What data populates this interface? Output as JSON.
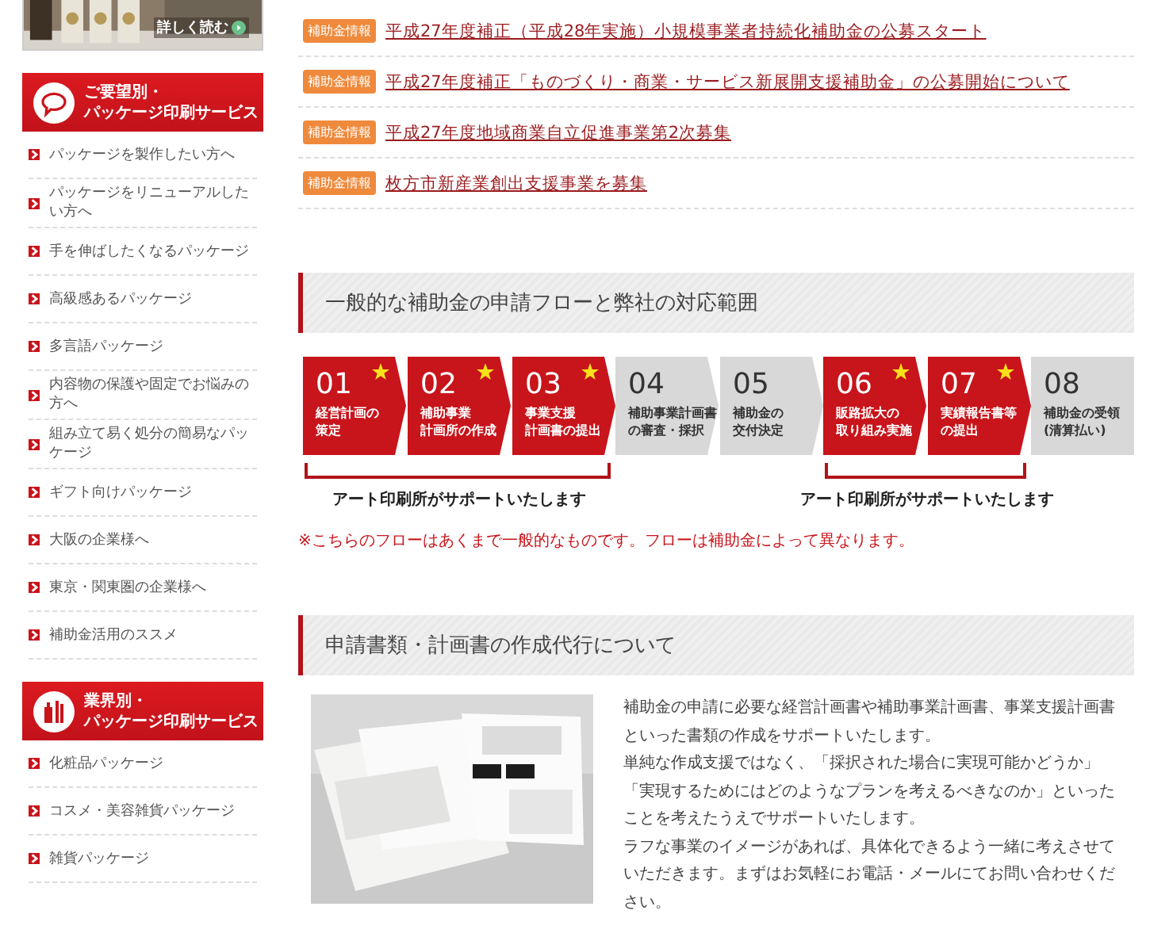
{
  "sidebar": {
    "banner": {
      "link": "詳しく読む"
    },
    "sections": [
      {
        "title": [
          "ご要望別・",
          "パッケージ印刷サービス"
        ],
        "items": [
          "パッケージを製作したい方へ",
          "パッケージをリニューアルしたい方へ",
          "手を伸ばしたくなるパッケージ",
          "高級感あるパッケージ",
          "多言語パッケージ",
          "内容物の保護や固定でお悩みの方へ",
          "組み立て易く処分の簡易なパッケージ",
          "ギフト向けパッケージ",
          "大阪の企業様へ",
          "東京・関東圏の企業様へ",
          "補助金活用のススメ"
        ]
      },
      {
        "title": [
          "業界別・",
          "パッケージ印刷サービス"
        ],
        "items": [
          "化粧品パッケージ",
          "コスメ・美容雑貨パッケージ",
          "雑貨パッケージ"
        ]
      }
    ]
  },
  "news": [
    {
      "tag": "補助金情報",
      "title": "平成27年度補正（平成28年実施）小規模事業者持続化補助金の公募スタート"
    },
    {
      "tag": "補助金情報",
      "title": "平成27年度補正「ものづくり・商業・サービス新展開支援補助金」の公募開始について"
    },
    {
      "tag": "補助金情報",
      "title": "平成27年度地域商業自立促進事業第2次募集"
    },
    {
      "tag": "補助金情報",
      "title": "枚方市新産業創出支援事業を募集"
    }
  ],
  "flow": {
    "heading": "一般的な補助金の申請フローと弊社の対応範囲",
    "segments": [
      {
        "supported": true,
        "label": "アート印刷所がサポートいたします",
        "steps": [
          {
            "number": "01",
            "label": [
              "経営計画の",
              "策定"
            ],
            "highlighted": true,
            "starred": true,
            "kind": "arrow"
          },
          {
            "number": "02",
            "label": [
              "補助事業",
              "計画所の作成"
            ],
            "highlighted": true,
            "starred": true,
            "kind": "arrow"
          },
          {
            "number": "03",
            "label": [
              "事業支援",
              "計画書の提出"
            ],
            "highlighted": true,
            "starred": true,
            "kind": "arrow"
          }
        ]
      },
      {
        "supported": false,
        "steps": [
          {
            "number": "04",
            "label": [
              "補助事業計画書",
              "の審査・採択"
            ],
            "highlighted": false,
            "starred": false,
            "kind": "arrow"
          },
          {
            "number": "05",
            "label": [
              "補助金の",
              "交付決定"
            ],
            "highlighted": false,
            "starred": false,
            "kind": "arrow"
          }
        ]
      },
      {
        "supported": true,
        "label": "アート印刷所がサポートいたします",
        "steps": [
          {
            "number": "06",
            "label": [
              "販路拡大の",
              "取り組み実施"
            ],
            "highlighted": true,
            "starred": true,
            "kind": "arrow"
          },
          {
            "number": "07",
            "label": [
              "実績報告書等",
              "の提出"
            ],
            "highlighted": true,
            "starred": true,
            "kind": "arrow"
          }
        ]
      },
      {
        "supported": false,
        "steps": [
          {
            "number": "08",
            "label": [
              "補助金の受領",
              "(清算払い)"
            ],
            "highlighted": false,
            "starred": false,
            "kind": "end"
          }
        ]
      }
    ],
    "note": "※こちらのフローはあくまで一般的なものです。フローは補助金によって異なります。"
  },
  "service": {
    "heading": "申請書類・計画書の作成代行について",
    "paragraphs": [
      "補助金の申請に必要な経営計画書や補助事業計画書、事業支援計画書といった書類の作成をサポートいたします。",
      "単純な作成支援ではなく、「採択された場合に実現可能かどうか」「実現するためにはどのようなプランを考えるべきなのか」といったことを考えたうえでサポートいたします。",
      "ラフな事業のイメージがあれば、具体化できるよう一緒に考えさせていただきます。まずはお気軽にお電話・メールにてお問い合わせください。"
    ]
  }
}
